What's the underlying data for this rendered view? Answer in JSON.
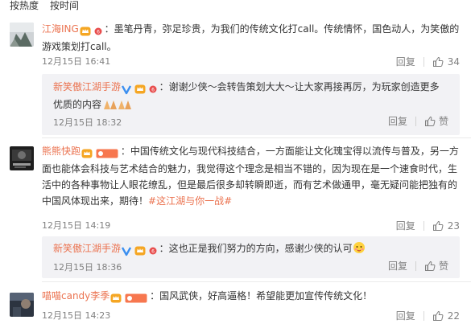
{
  "sort": {
    "hot": "按热度",
    "time": "按时间"
  },
  "comments": [
    {
      "user": "江海ING",
      "text": "：墨笔丹青，弥足珍贵，为我们的传统文化打call。传统情怀，国色动人，为笑傲的游戏策划打call。",
      "time": "12月15日 16:41",
      "reply_label": "回复",
      "likes": "34",
      "reply": {
        "user": "新笑傲江湖手游",
        "text": "：谢谢少侠～会转告策划大大～让大家再接再厉，为玩家创造更多优质的内容",
        "time": "12月15日 18:32",
        "reply_label": "回复",
        "like_label": "赞"
      }
    },
    {
      "user": "熊熊快跑",
      "fan_badge": "铁粉",
      "text": "：中国传统文化与现代科技结合，一方面能让文化瑰宝得以流传与普及，另一方面也能体会科技与艺术结合的魅力，我觉得这个理念是相当不错的，因为现在是一个速食时代，生活中的各种事物让人眼花缭乱，但是最后很多却转瞬即逝，而有艺术做通甲，毫无疑问能把独有的中国风体现出来，期待！",
      "topic": "#这江湖与你一战#",
      "time": "12月15日 14:19",
      "reply_label": "回复",
      "likes": "23",
      "reply": {
        "user": "新笑傲江湖手游",
        "text": "：这也正是我们努力的方向，感谢少侠的认可",
        "time": "12月15日 18:36",
        "reply_label": "回复",
        "like_label": "赞"
      }
    },
    {
      "user": "喵喵candy李季",
      "fan_badge": "铁粉",
      "text": "：国风武侠，好高逼格！希望能更加宣传传统文化！",
      "time": "12月15日 14:23",
      "reply_label": "回复",
      "likes": "22"
    }
  ],
  "colors": {
    "username": "#eb7350",
    "meta": "#808080",
    "reply_bg": "#f2f2f5",
    "verified": "#3b8ff0"
  }
}
